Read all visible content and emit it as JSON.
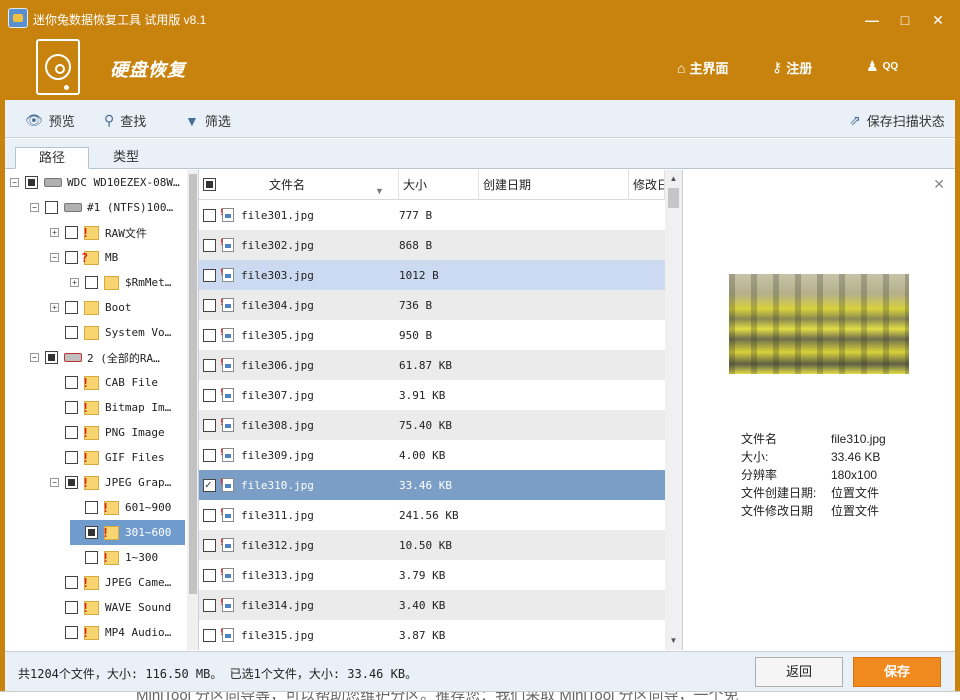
{
  "window": {
    "title": "迷你兔数据恢复工具 试用版 v8.1",
    "section_title": "硬盘恢复",
    "minimize": "—",
    "maximize": "□",
    "close": "✕"
  },
  "nav": {
    "home": "主界面",
    "register": "注册",
    "qq": "QQ"
  },
  "toolbar": {
    "preview": "预览",
    "search": "查找",
    "filter": "筛选",
    "save_scan": "保存扫描状态"
  },
  "tabs": {
    "path": "路径",
    "type": "类型"
  },
  "tree": [
    {
      "label": "WDC WD10EZEX-08W…",
      "level": 0,
      "check": "partial",
      "icon": "hdd"
    },
    {
      "label": "#1 (NTFS)100…",
      "level": 1,
      "check": "none",
      "icon": "hdd"
    },
    {
      "label": "RAW文件",
      "level": 2,
      "check": "none",
      "icon": "folder-red"
    },
    {
      "label": "MB",
      "level": 2,
      "check": "none",
      "icon": "folder-q"
    },
    {
      "label": "$RmMet…",
      "level": 3,
      "check": "none",
      "icon": "folder"
    },
    {
      "label": "Boot",
      "level": 2,
      "check": "none",
      "icon": "folder"
    },
    {
      "label": "System Vo…",
      "level": 2,
      "check": "none",
      "icon": "folder"
    },
    {
      "label": "2 (全部的RA…",
      "level": 1,
      "check": "partial",
      "icon": "hdd-red"
    },
    {
      "label": "CAB File",
      "level": 2,
      "check": "none",
      "icon": "folder-red"
    },
    {
      "label": "Bitmap Im…",
      "level": 2,
      "check": "none",
      "icon": "folder-red"
    },
    {
      "label": "PNG Image",
      "level": 2,
      "check": "none",
      "icon": "folder-red"
    },
    {
      "label": "GIF Files",
      "level": 2,
      "check": "none",
      "icon": "folder-red"
    },
    {
      "label": "JPEG Grap…",
      "level": 2,
      "check": "partial",
      "icon": "folder-red"
    },
    {
      "label": "601~900",
      "level": 3,
      "check": "none",
      "icon": "folder-red"
    },
    {
      "label": "301~600",
      "level": 3,
      "check": "partial",
      "icon": "folder-red"
    },
    {
      "label": "1~300",
      "level": 3,
      "check": "none",
      "icon": "folder-red"
    },
    {
      "label": "JPEG Came…",
      "level": 2,
      "check": "none",
      "icon": "folder-red"
    },
    {
      "label": "WAVE Sound",
      "level": 2,
      "check": "none",
      "icon": "folder-red"
    },
    {
      "label": "MP4 Audio…",
      "level": 2,
      "check": "none",
      "icon": "folder-red"
    }
  ],
  "columns": {
    "name": "文件名",
    "size": "大小",
    "created": "创建日期",
    "modified": "修改日"
  },
  "files": [
    {
      "name": "file301.jpg",
      "size": "777 B"
    },
    {
      "name": "file302.jpg",
      "size": "868 B"
    },
    {
      "name": "file303.jpg",
      "size": "1012 B"
    },
    {
      "name": "file304.jpg",
      "size": "736 B"
    },
    {
      "name": "file305.jpg",
      "size": "950 B"
    },
    {
      "name": "file306.jpg",
      "size": "61.87 KB"
    },
    {
      "name": "file307.jpg",
      "size": "3.91 KB"
    },
    {
      "name": "file308.jpg",
      "size": "75.40 KB"
    },
    {
      "name": "file309.jpg",
      "size": "4.00 KB"
    },
    {
      "name": "file310.jpg",
      "size": "33.46 KB"
    },
    {
      "name": "file311.jpg",
      "size": "241.56 KB"
    },
    {
      "name": "file312.jpg",
      "size": "10.50 KB"
    },
    {
      "name": "file313.jpg",
      "size": "3.79 KB"
    },
    {
      "name": "file314.jpg",
      "size": "3.40 KB"
    },
    {
      "name": "file315.jpg",
      "size": "3.87 KB"
    }
  ],
  "preview_info": {
    "name_label": "文件名",
    "name_value": "file310.jpg",
    "size_label": "大小:",
    "size_value": "33.46 KB",
    "resolution_label": "分辨率",
    "resolution_value": "180x100",
    "created_label": "文件创建日期:",
    "created_value": "位置文件",
    "modified_label": "文件修改日期",
    "modified_value": "位置文件"
  },
  "status": {
    "summary": "共1204个文件，大小: 116.50 MB。 已选1个文件，大小: 33.46 KB。",
    "back": "返回",
    "save": "保存"
  },
  "bottom_text": "MiniTool 分区向导等，可以帮助您维护分区。推荐您：我们采取 MiniTool 分区向导，一个免"
}
